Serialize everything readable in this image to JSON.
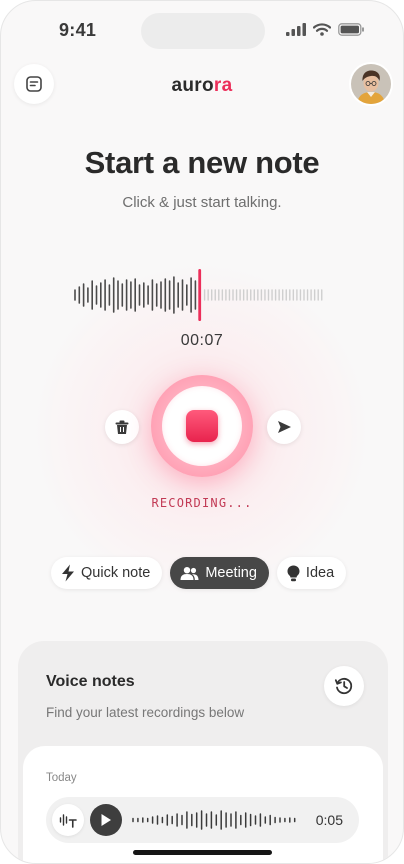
{
  "status_bar": {
    "time": "9:41"
  },
  "header": {
    "brand_prefix": "auro",
    "brand_accent": "ra"
  },
  "hero": {
    "title": "Start a new note",
    "subtitle": "Click & just start talking."
  },
  "recorder": {
    "elapsed": "00:07",
    "state": "RECORDING...",
    "waveform_recorded": [
      10,
      16,
      22,
      14,
      28,
      18,
      24,
      30,
      20,
      34,
      28,
      22,
      30,
      26,
      32,
      20,
      24,
      18,
      30,
      22,
      26,
      32,
      28,
      36,
      24,
      30,
      20,
      34,
      28
    ],
    "waveform_pending_bars": 34,
    "accent_color": "#ec2e5a"
  },
  "modes": [
    {
      "label": "Quick note",
      "icon": "bolt-icon",
      "active": false
    },
    {
      "label": "Meeting",
      "icon": "users-icon",
      "active": true
    },
    {
      "label": "Idea",
      "icon": "lightbulb-icon",
      "active": false
    }
  ],
  "voice_notes": {
    "title": "Voice notes",
    "subtitle": "Find your latest recordings below",
    "groups": [
      {
        "date_label": "Today",
        "items": [
          {
            "duration": "0:05",
            "waveform": [
              3,
              3,
              4,
              3,
              6,
              8,
              5,
              10,
              7,
              12,
              9,
              16,
              11,
              14,
              18,
              12,
              16,
              10,
              18,
              14,
              12,
              16,
              9,
              14,
              11,
              8,
              12,
              6,
              9,
              5,
              4,
              3,
              4,
              3
            ]
          }
        ]
      }
    ]
  }
}
